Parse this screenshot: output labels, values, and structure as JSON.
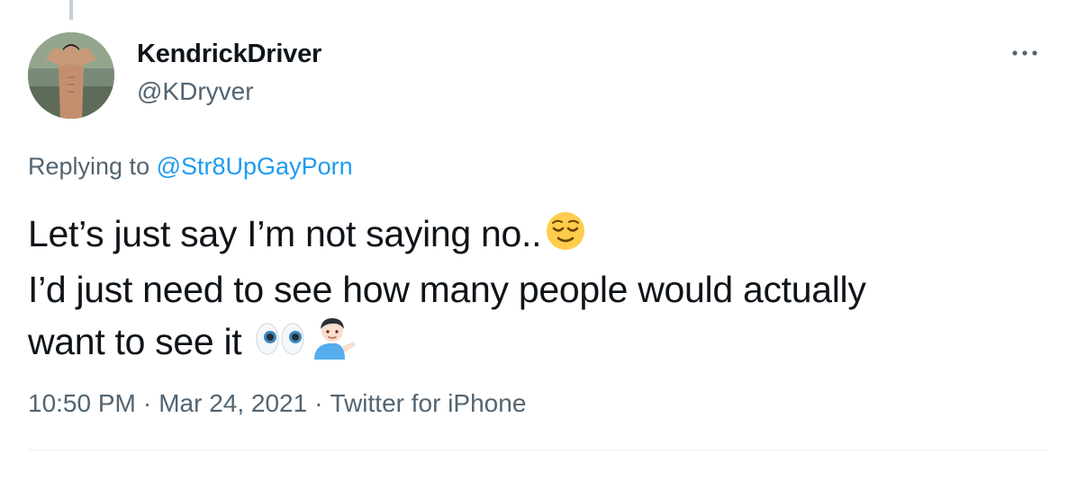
{
  "tweet": {
    "display_name": "KendrickDriver",
    "handle": "@KDryver",
    "replying_to_label": "Replying to",
    "replying_to_handle": "@Str8UpGayPorn",
    "text_lines": [
      "Let’s just say I’m not saying no..",
      "I’d just need to see how many people would actually",
      "want to see it"
    ],
    "emojis": [
      "relieved-face",
      "eyes",
      "person-tipping-hand"
    ],
    "time": "10:50 PM",
    "separator": "·",
    "date": "Mar 24, 2021",
    "source": "Twitter for iPhone",
    "more_icon": "more-dots-icon"
  },
  "colors": {
    "text_primary": "#0f1419",
    "text_secondary": "#536471",
    "link": "#1d9bf0",
    "thread_line": "#c4cfd6",
    "divider": "#eff3f4"
  }
}
